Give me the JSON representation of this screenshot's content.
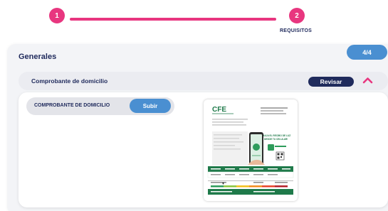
{
  "stepper": {
    "steps": [
      {
        "number": "1",
        "label": ""
      },
      {
        "number": "2",
        "label": "REQUISITOS"
      }
    ],
    "accent_color": "#e8367f"
  },
  "section": {
    "title": "Generales",
    "count": "4/4"
  },
  "document_group": {
    "title": "Comprobante de domicilio",
    "review_label": "Revisar",
    "chevron": "chevron-up-icon"
  },
  "file": {
    "label": "COMPROBANTE DE DOMICILIO",
    "upload_label": "Subir"
  },
  "preview": {
    "logo_text": "CFE",
    "banner_text": "¡BAJA EL RECIBO DE LUZ DESDE TU CELULAR!"
  },
  "colors": {
    "navy": "#1f2a5c",
    "blue": "#4a8fd1",
    "pink": "#e8367f",
    "green": "#1f7a4a"
  }
}
